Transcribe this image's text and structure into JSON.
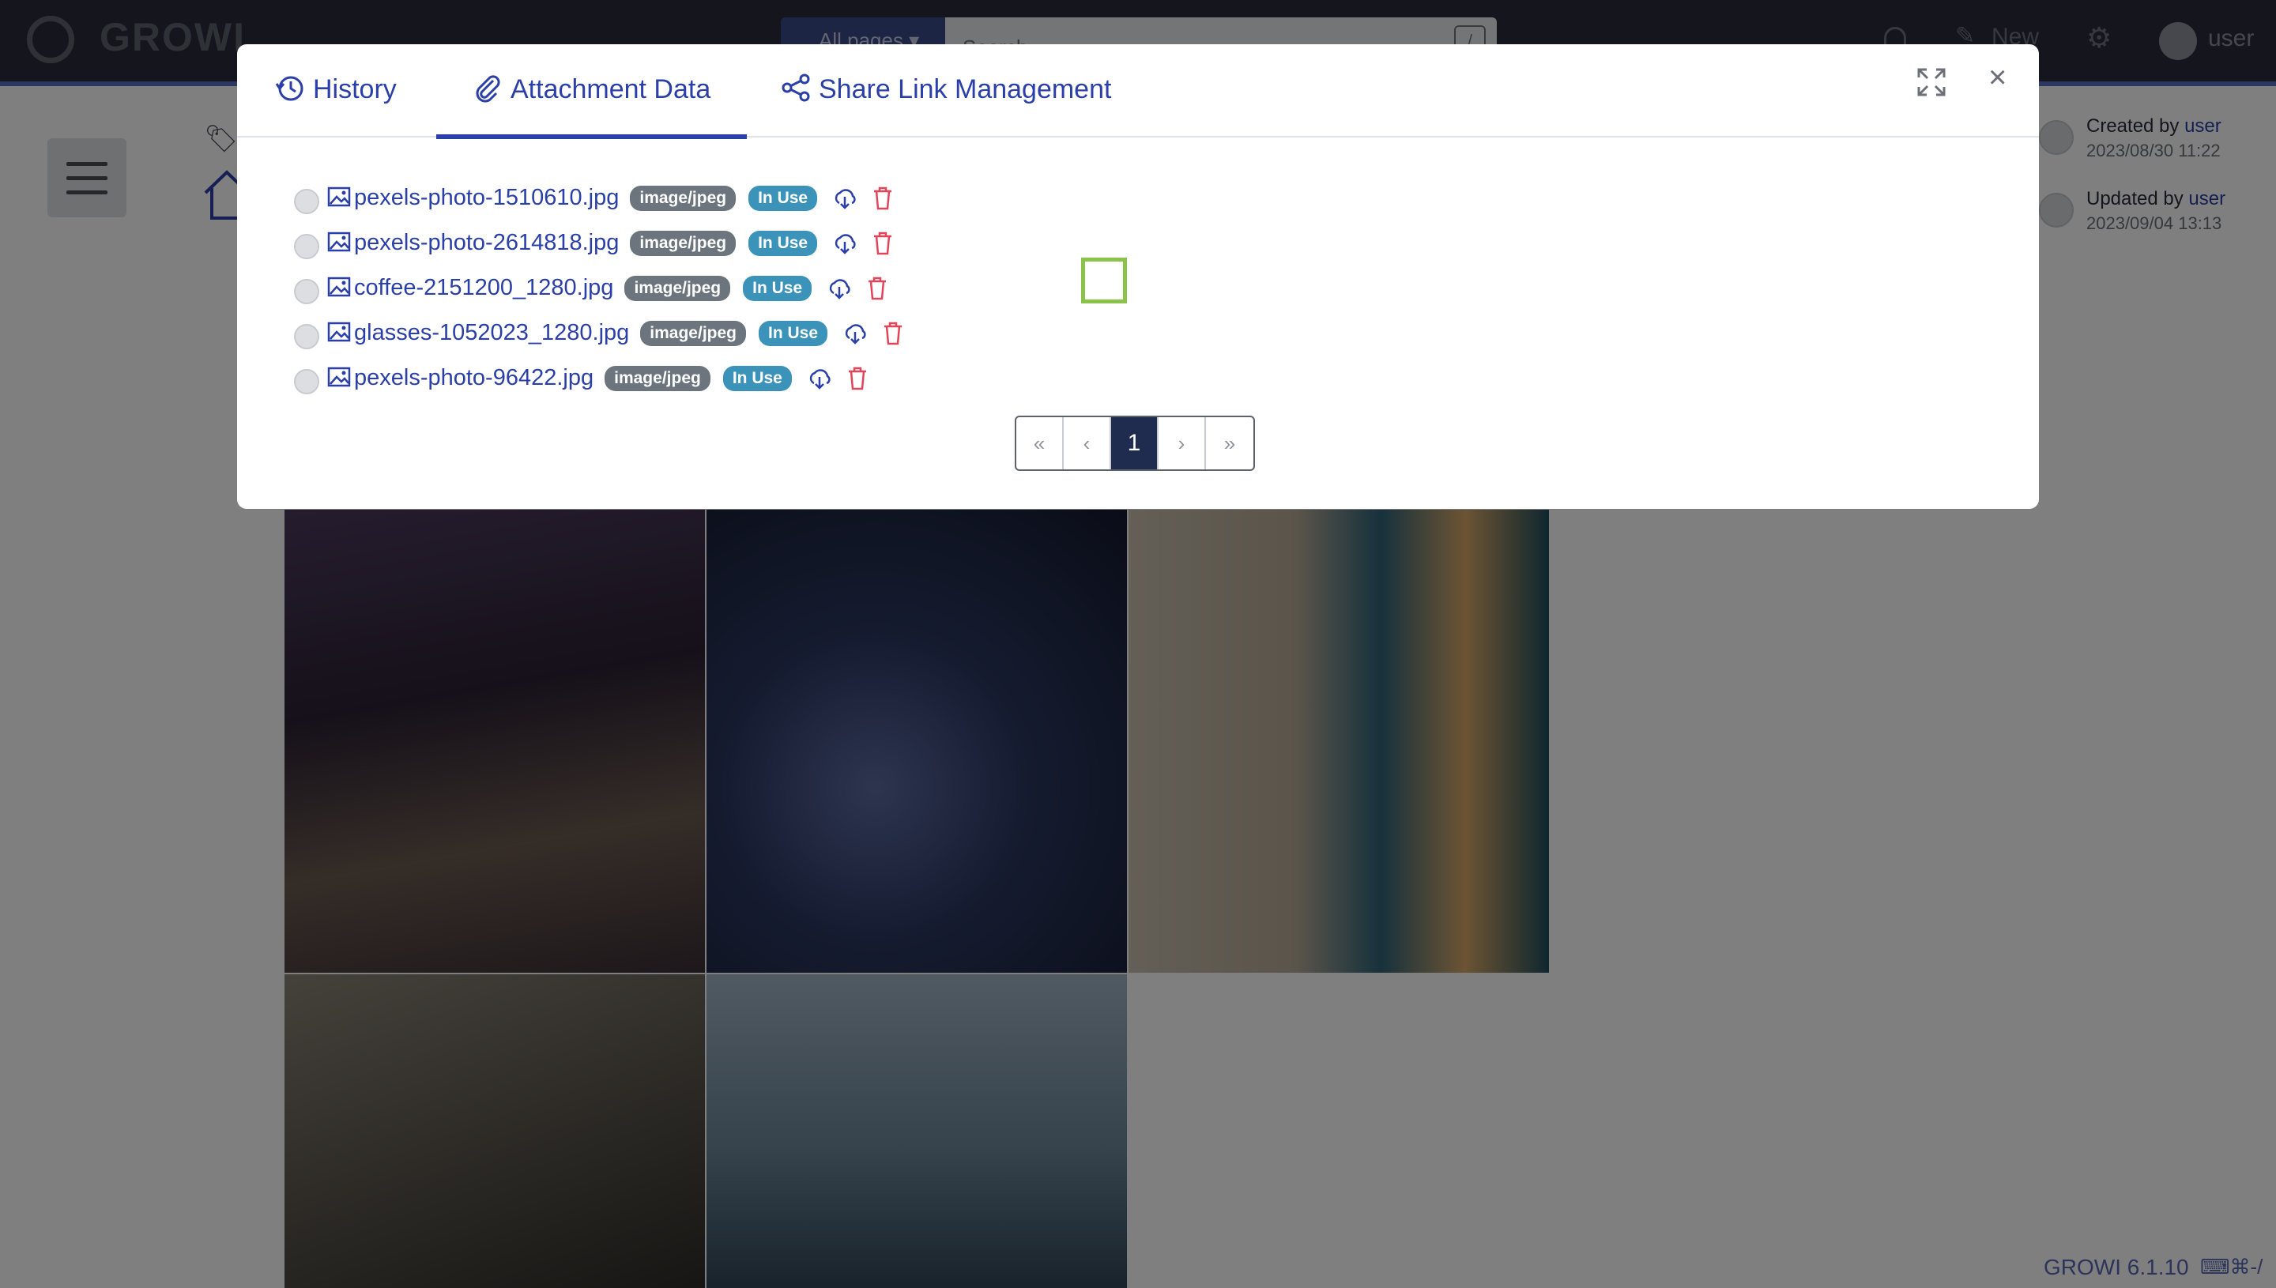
{
  "navbar": {
    "logo_text": "GROWI",
    "search_scope": "All pages ▾",
    "search_placeholder": "Search...",
    "search_shortcut": "/",
    "new_label": "New",
    "user_label": "user"
  },
  "page_meta": {
    "created_prefix": "Created by ",
    "created_user": "user",
    "created_date": "2023/08/30 11:22",
    "updated_prefix": "Updated by ",
    "updated_user": "user",
    "updated_date": "2023/09/04 13:13"
  },
  "footer": {
    "version": "GROWI 6.1.10",
    "shortcut": "⌨⌘-/"
  },
  "modal": {
    "tabs": [
      {
        "label": "History",
        "icon": "history-icon"
      },
      {
        "label": "Attachment Data",
        "icon": "paperclip-icon",
        "active": true
      },
      {
        "label": "Share Link Management",
        "icon": "share-icon"
      }
    ],
    "attachments": [
      {
        "name": "pexels-photo-1510610.jpg",
        "mime": "image/jpeg",
        "status": "In Use"
      },
      {
        "name": "pexels-photo-2614818.jpg",
        "mime": "image/jpeg",
        "status": "In Use"
      },
      {
        "name": "coffee-2151200_1280.jpg",
        "mime": "image/jpeg",
        "status": "In Use"
      },
      {
        "name": "glasses-1052023_1280.jpg",
        "mime": "image/jpeg",
        "status": "In Use"
      },
      {
        "name": "pexels-photo-96422.jpg",
        "mime": "image/jpeg",
        "status": "In Use"
      }
    ],
    "pagination": {
      "first": "«",
      "prev": "‹",
      "current": "1",
      "next": "›",
      "last": "»"
    }
  },
  "colors": {
    "accent": "#2b3fa8",
    "danger": "#e0455a",
    "highlight": "#8bc34a",
    "badge_gray": "#6c757d",
    "badge_info": "#3b93b9"
  }
}
